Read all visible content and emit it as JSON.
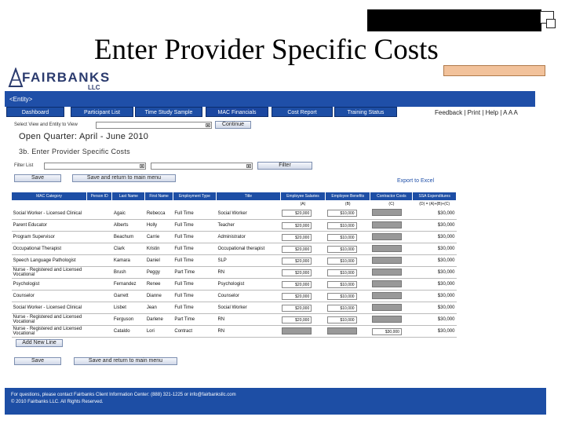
{
  "slide": {
    "title": "Enter Provider Specific Costs"
  },
  "logo": {
    "name": "FAIRBANKS",
    "sub": "LLC"
  },
  "entity_bar": {
    "label": "<Entity>"
  },
  "nav": {
    "tabs": [
      "Dashboard",
      "Participant List",
      "Time Study Sample",
      "MAC Financials",
      "Cost Report",
      "Training Status"
    ]
  },
  "util_links": "Feedback | Print | Help | A A A",
  "filters": {
    "select_view_label": "Select View and Entity to View",
    "continue_button": "Continue",
    "filter_label": "Filter List",
    "filter_button": "Filter"
  },
  "quarter_heading": "Open Quarter: April - June 2010",
  "subheading": "3b. Enter Provider Specific Costs",
  "top_buttons": {
    "save": "Save",
    "save_return": "Save and return to main menu"
  },
  "export_link": "Export to Excel",
  "table": {
    "headers": [
      "MAC Category",
      "Person ID",
      "Last Name",
      "First Name",
      "Employment Type",
      "Title",
      "Employee Salaries",
      "Employee Benefits",
      "Contractor Costs",
      "SSA Expenditures"
    ],
    "subheaders": [
      "",
      "",
      "",
      "",
      "",
      "",
      "(A)",
      "(B)",
      "(C)",
      "(D) = (A)+(B)+(C)"
    ],
    "rows": [
      {
        "category": "Social Worker - Licensed Clinical",
        "person_id": "",
        "last": "Agaic",
        "first": "Rebecca",
        "type": "Full Time",
        "title": "Social Worker",
        "salary": "$20,000",
        "benefits": "$10,000",
        "contractor": "",
        "expend": "$30,000"
      },
      {
        "category": "Parent Educator",
        "person_id": "",
        "last": "Alberts",
        "first": "Holly",
        "type": "Full Time",
        "title": "Teacher",
        "salary": "$20,000",
        "benefits": "$10,000",
        "contractor": "",
        "expend": "$30,000"
      },
      {
        "category": "Program Supervisor",
        "person_id": "",
        "last": "Beachum",
        "first": "Carrie",
        "type": "Full Time",
        "title": "Administrator",
        "salary": "$20,000",
        "benefits": "$10,000",
        "contractor": "",
        "expend": "$30,000"
      },
      {
        "category": "Occupational Therapist",
        "person_id": "",
        "last": "Clark",
        "first": "Kristin",
        "type": "Full Time",
        "title": "Occupational therapist",
        "salary": "$20,000",
        "benefits": "$10,000",
        "contractor": "",
        "expend": "$30,000"
      },
      {
        "category": "Speech Language Pathologist",
        "person_id": "",
        "last": "Kamara",
        "first": "Daniel",
        "type": "Full Time",
        "title": "SLP",
        "salary": "$20,000",
        "benefits": "$10,000",
        "contractor": "",
        "expend": "$30,000"
      },
      {
        "category": "Nurse - Registered and Licensed Vocational",
        "person_id": "",
        "last": "Brush",
        "first": "Peggy",
        "type": "Part Time",
        "title": "RN",
        "salary": "$20,000",
        "benefits": "$10,000",
        "contractor": "",
        "expend": "$30,000"
      },
      {
        "category": "Psychologist",
        "person_id": "",
        "last": "Fernandez",
        "first": "Renee",
        "type": "Full Time",
        "title": "Psychologist",
        "salary": "$20,000",
        "benefits": "$10,000",
        "contractor": "",
        "expend": "$30,000"
      },
      {
        "category": "Counselor",
        "person_id": "",
        "last": "Garrett",
        "first": "Dianne",
        "type": "Full Time",
        "title": "Counselor",
        "salary": "$20,000",
        "benefits": "$10,000",
        "contractor": "",
        "expend": "$30,000"
      },
      {
        "category": "Social Worker - Licensed Clinical",
        "person_id": "",
        "last": "Lisbet",
        "first": "Jean",
        "type": "Full Time",
        "title": "Social Worker",
        "salary": "$20,000",
        "benefits": "$10,000",
        "contractor": "",
        "expend": "$30,000"
      },
      {
        "category": "Nurse - Registered and Licensed Vocational",
        "person_id": "",
        "last": "Ferguson",
        "first": "Darlene",
        "type": "Part Time",
        "title": "RN",
        "salary": "$20,000",
        "benefits": "$10,000",
        "contractor": "",
        "expend": "$30,000"
      },
      {
        "category": "Nurse - Registered and Licensed Vocational",
        "person_id": "",
        "last": "Cataldo",
        "first": "Lori",
        "type": "Contract",
        "title": "RN",
        "salary": "",
        "benefits": "",
        "contractor": "$30,000",
        "expend": "$30,000"
      }
    ]
  },
  "bottom_buttons": {
    "add_new_line": "Add New Line",
    "save": "Save",
    "save_return": "Save and return to main menu"
  },
  "footer": {
    "line1": "For questions, please contact Fairbanks Client Information Center: (888) 321-1225 or info@fairbanksllc.com",
    "line2": "© 2010 Fairbanks LLC. All Rights Reserved."
  }
}
